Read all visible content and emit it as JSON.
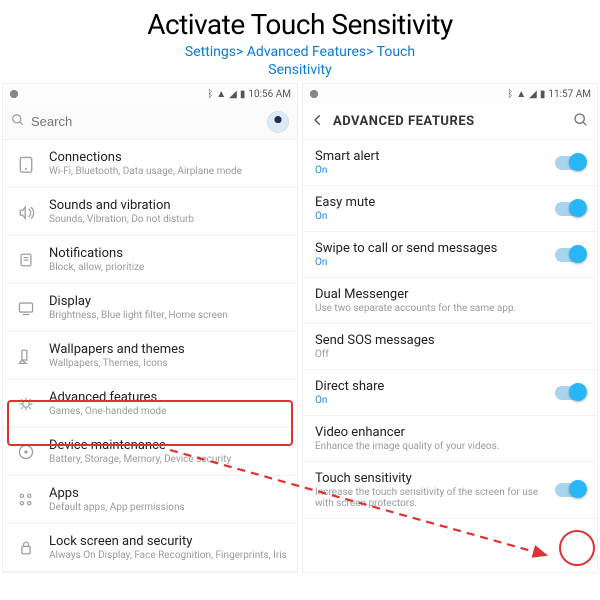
{
  "header": {
    "title": "Activate Touch Sensitivity",
    "breadcrumb_line1": "Settings> Advanced Features> Touch",
    "breadcrumb_line2": "Sensitivity"
  },
  "left": {
    "status_time": "10:56 AM",
    "search_placeholder": "Search",
    "items": [
      {
        "t": "Connections",
        "s": "Wi-Fi, Bluetooth, Data usage, Airplane mode"
      },
      {
        "t": "Sounds and vibration",
        "s": "Sounds, Vibration, Do not disturb"
      },
      {
        "t": "Notifications",
        "s": "Block, allow, prioritize"
      },
      {
        "t": "Display",
        "s": "Brightness, Blue light filter, Home screen"
      },
      {
        "t": "Wallpapers and themes",
        "s": "Wallpapers, Themes, Icons"
      },
      {
        "t": "Advanced features",
        "s": "Games, One-handed mode"
      },
      {
        "t": "Device maintenance",
        "s": "Battery, Storage, Memory, Device security"
      },
      {
        "t": "Apps",
        "s": "Default apps, App permissions"
      },
      {
        "t": "Lock screen and security",
        "s": "Always On Display, Face Recognition, Fingerprints, Iris"
      }
    ]
  },
  "right": {
    "status_time": "11:57 AM",
    "title": "ADVANCED FEATURES",
    "rows": [
      {
        "t": "Smart alert",
        "s": "On",
        "on": true,
        "toggle": true
      },
      {
        "t": "Easy mute",
        "s": "On",
        "on": true,
        "toggle": true
      },
      {
        "t": "Swipe to call or send messages",
        "s": "On",
        "on": true,
        "toggle": true
      },
      {
        "t": "Dual Messenger",
        "s": "Use two separate accounts for the same app.",
        "on": false,
        "toggle": false
      },
      {
        "t": "Send SOS messages",
        "s": "Off",
        "on": false,
        "toggle": false
      },
      {
        "t": "Direct share",
        "s": "On",
        "on": true,
        "toggle": true
      },
      {
        "t": "Video enhancer",
        "s": "Enhance the image quality of your videos.",
        "on": false,
        "toggle": false
      },
      {
        "t": "Touch sensitivity",
        "s": "Increase the touch sensitivity of the screen for use with screen protectors.",
        "on": true,
        "toggle": true
      }
    ]
  }
}
